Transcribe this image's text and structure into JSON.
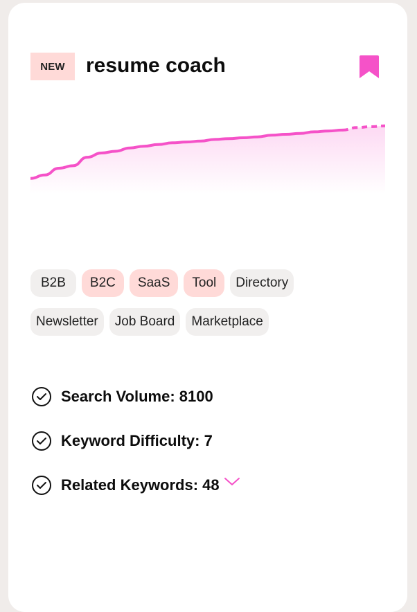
{
  "badge": "NEW",
  "title": "resume coach",
  "colors": {
    "accent": "#f552c8",
    "tag_highlight": "#ffdad8",
    "tag_default": "#f1efee",
    "background": "#f0ecea"
  },
  "icons": {
    "bookmark": "bookmark-icon",
    "check": "check-circle-icon",
    "expand": "chevron-down-icon"
  },
  "chart_data": {
    "type": "area",
    "x": [
      0,
      1,
      2,
      3,
      4,
      5,
      6,
      7,
      8,
      9,
      10,
      11,
      12,
      13,
      14,
      15,
      16,
      17,
      18,
      19,
      20,
      21,
      22,
      23,
      24,
      25
    ],
    "values": [
      10,
      14,
      22,
      25,
      35,
      40,
      42,
      46,
      48,
      50,
      52,
      53,
      54,
      56,
      57,
      58,
      59,
      61,
      62,
      63,
      65,
      66,
      67,
      70,
      71,
      72
    ],
    "projected_from_index": 22,
    "title": "",
    "xlabel": "",
    "ylabel": "",
    "grid": false
  },
  "tags": {
    "row1": [
      {
        "label": "B2B",
        "highlighted": false
      },
      {
        "label": "B2C",
        "highlighted": true
      },
      {
        "label": "SaaS",
        "highlighted": true
      },
      {
        "label": "Tool",
        "highlighted": true
      },
      {
        "label": "Directory",
        "highlighted": false
      }
    ],
    "row2": [
      {
        "label": "Newsletter",
        "highlighted": false
      },
      {
        "label": "Job Board",
        "highlighted": false
      },
      {
        "label": "Marketplace",
        "highlighted": false
      }
    ]
  },
  "metrics": {
    "search_volume": "Search Volume: 8100",
    "keyword_difficulty": "Keyword Difficulty: 7",
    "related_keywords": "Related Keywords: 48"
  }
}
